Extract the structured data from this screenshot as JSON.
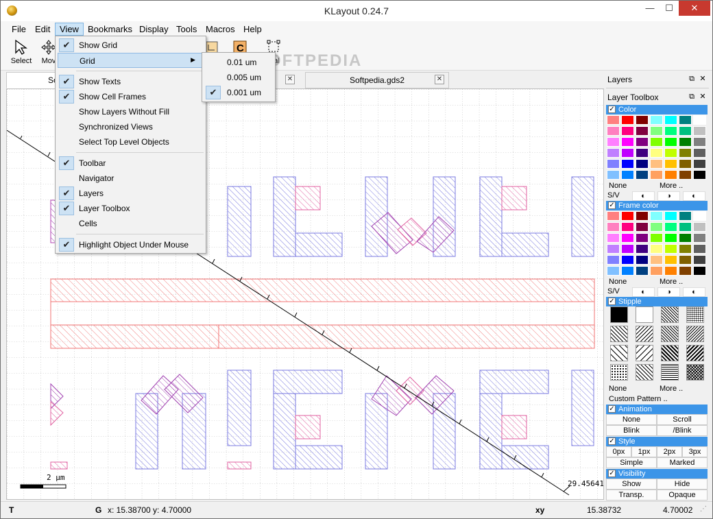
{
  "window": {
    "title": "KLayout 0.24.7",
    "min": "—",
    "max": "☐",
    "close": "✕"
  },
  "menubar": [
    "File",
    "Edit",
    "View",
    "Bookmarks",
    "Display",
    "Tools",
    "Macros",
    "Help"
  ],
  "toolbar": {
    "select": "Select",
    "move": "Mov",
    "partial": "rtial",
    "watermark": "SOFTPEDIA"
  },
  "tabs": [
    {
      "label": "Sof"
    },
    {
      "label": "Softpedia.gds2"
    }
  ],
  "view_menu": {
    "items": [
      {
        "label": "Show Grid",
        "checked": true
      },
      {
        "label": "Grid",
        "submenu": true
      },
      {
        "label": "Show Texts",
        "checked": true
      },
      {
        "label": "Show Cell Frames",
        "checked": true
      },
      {
        "label": "Show Layers Without Fill",
        "checked": false
      },
      {
        "label": "Synchronized Views",
        "checked": false
      },
      {
        "label": "Select Top Level Objects",
        "checked": false
      },
      {
        "label": "Toolbar",
        "checked": true
      },
      {
        "label": "Navigator",
        "checked": false
      },
      {
        "label": "Layers",
        "checked": true
      },
      {
        "label": "Layer Toolbox",
        "checked": true
      },
      {
        "label": "Cells",
        "checked": false
      },
      {
        "label": "Highlight Object Under Mouse",
        "checked": true
      }
    ]
  },
  "grid_menu": {
    "items": [
      {
        "label": "0.01 um",
        "checked": false
      },
      {
        "label": "0.005 um",
        "checked": false
      },
      {
        "label": "0.001 um",
        "checked": true
      }
    ]
  },
  "canvas": {
    "scale_label": "2 µm",
    "coord_readout": "29.45641"
  },
  "panels": {
    "layers_title": "Layers",
    "toolbox_title": "Layer Toolbox",
    "color": "Color",
    "frame_color": "Frame color",
    "stipple": "Stipple",
    "none": "None",
    "more": "More ..",
    "sv": "S/V",
    "custom_pattern": "Custom Pattern ..",
    "animation": "Animation",
    "animation_buttons": [
      "None",
      "Scroll",
      "Blink",
      "/Blink"
    ],
    "style": "Style",
    "style_widths": [
      "0px",
      "1px",
      "2px",
      "3px"
    ],
    "style_buttons": [
      "Simple",
      "Marked"
    ],
    "visibility": "Visibility",
    "visibility_buttons": [
      "Show",
      "Hide",
      "Transp.",
      "Opaque"
    ]
  },
  "palette": [
    "#ff8080",
    "#ff0000",
    "#800000",
    "#80ffff",
    "#00ffff",
    "#008080",
    "#ffffff",
    "#ff80c0",
    "#ff0080",
    "#800040",
    "#80ff80",
    "#00ff80",
    "#00c080",
    "#c0c0c0",
    "#ff80ff",
    "#ff00ff",
    "#800080",
    "#80ff00",
    "#00ff00",
    "#008000",
    "#808080",
    "#c080ff",
    "#c000ff",
    "#400080",
    "#ffff80",
    "#c0ff00",
    "#808000",
    "#606060",
    "#8080ff",
    "#0000ff",
    "#000080",
    "#ffc080",
    "#ffc000",
    "#806000",
    "#404040",
    "#80c0ff",
    "#0080ff",
    "#004080",
    "#ffa060",
    "#ff8000",
    "#804000",
    "#000000"
  ],
  "statusbar": {
    "t": "T",
    "g": "G",
    "xy_label": "x: 15.38700  y: 4.70000",
    "xy": "xy",
    "x_val": "15.38732",
    "y_val": "4.70002"
  }
}
